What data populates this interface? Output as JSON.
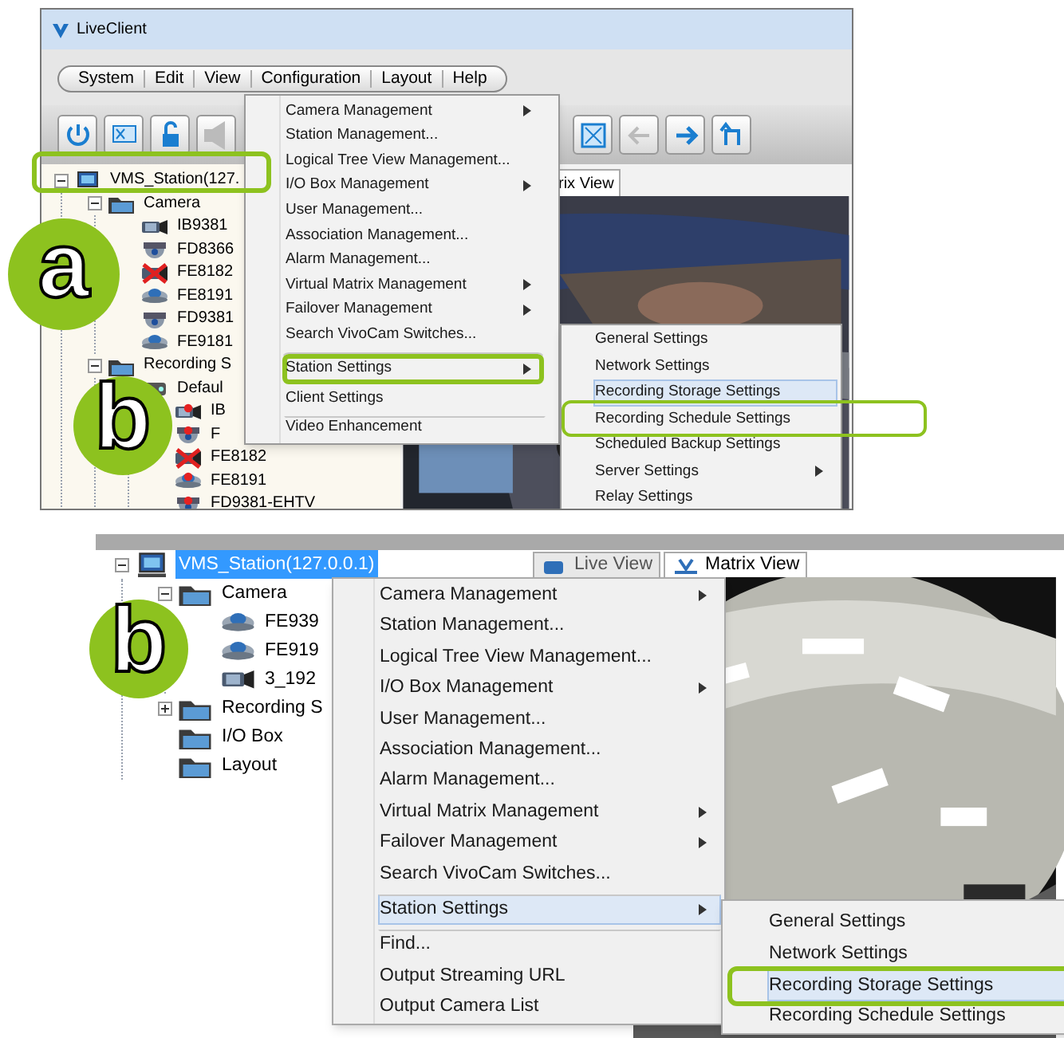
{
  "top_screenshot": {
    "window_title": "LiveClient",
    "menu_bar": [
      "System",
      "Edit",
      "View",
      "Configuration",
      "Layout",
      "Help"
    ],
    "tabs": [
      {
        "label": "rix View"
      }
    ],
    "tree": [
      {
        "label": "VMS_Station(127.",
        "kind": "station",
        "selected": false,
        "expanded": true,
        "children": [
          {
            "label": "Camera",
            "kind": "folder",
            "selected": false,
            "expanded": true,
            "children": [
              {
                "label": "IB9381",
                "kind": "bullet",
                "selected": false
              },
              {
                "label": "FD8366",
                "kind": "dome",
                "selected": false
              },
              {
                "label": "FE8182",
                "kind": "offline",
                "selected": false
              },
              {
                "label": "FE8191",
                "kind": "fisheye",
                "selected": false
              },
              {
                "label": "FD9381",
                "kind": "dome",
                "selected": false
              },
              {
                "label": "FE9181",
                "kind": "fisheye",
                "selected": false
              }
            ]
          },
          {
            "label": "Recording S",
            "kind": "folder",
            "selected": false,
            "expanded": true,
            "children": [
              {
                "label": "Defaul",
                "kind": "storage",
                "selected": false,
                "children": [
                  {
                    "label": "IB",
                    "kind": "bullet",
                    "recording": true,
                    "selected": false
                  },
                  {
                    "label": "F",
                    "kind": "dome",
                    "recording": true,
                    "selected": false
                  },
                  {
                    "label": "FE8182",
                    "kind": "offline",
                    "selected": false
                  },
                  {
                    "label": "FE8191",
                    "kind": "fisheye",
                    "recording": true,
                    "selected": false
                  },
                  {
                    "label": "FD9381-EHTV",
                    "kind": "dome",
                    "recording": true,
                    "selected": false
                  }
                ]
              }
            ]
          }
        ]
      }
    ],
    "context_menu": [
      {
        "label": "Camera Management",
        "has_submenu": true,
        "separator_before": false,
        "selected": false,
        "highlighted": false
      },
      {
        "label": "Station Management...",
        "has_submenu": false,
        "separator_before": false,
        "selected": false,
        "highlighted": false
      },
      {
        "label": "Logical Tree View Management...",
        "has_submenu": false,
        "separator_before": false,
        "selected": false,
        "highlighted": false
      },
      {
        "label": "I/O Box Management",
        "has_submenu": true,
        "separator_before": false,
        "selected": false,
        "highlighted": false
      },
      {
        "label": "User Management...",
        "has_submenu": false,
        "separator_before": false,
        "selected": false,
        "highlighted": false
      },
      {
        "label": "Association Management...",
        "has_submenu": false,
        "separator_before": false,
        "selected": false,
        "highlighted": false
      },
      {
        "label": "Alarm Management...",
        "has_submenu": false,
        "separator_before": false,
        "selected": false,
        "highlighted": false
      },
      {
        "label": "Virtual Matrix Management",
        "has_submenu": true,
        "separator_before": false,
        "selected": false,
        "highlighted": false
      },
      {
        "label": "Failover Management",
        "has_submenu": true,
        "separator_before": false,
        "selected": false,
        "highlighted": false
      },
      {
        "label": "Search VivoCam Switches...",
        "has_submenu": false,
        "separator_before": false,
        "selected": false,
        "highlighted": false
      },
      {
        "label": "Station Settings",
        "has_submenu": true,
        "separator_before": true,
        "selected": false,
        "highlighted": true
      },
      {
        "label": "Client Settings",
        "has_submenu": false,
        "separator_before": false,
        "selected": false,
        "highlighted": false
      },
      {
        "label": "Video Enhancement",
        "has_submenu": false,
        "separator_before": true,
        "selected": false,
        "highlighted": false
      }
    ],
    "submenu": [
      {
        "label": "General Settings",
        "has_submenu": false,
        "selected": false
      },
      {
        "label": "Network Settings",
        "has_submenu": false,
        "selected": false
      },
      {
        "label": "Recording Storage Settings",
        "has_submenu": false,
        "selected": true
      },
      {
        "label": "Recording Schedule Settings",
        "has_submenu": false,
        "selected": false
      },
      {
        "label": "Scheduled Backup Settings",
        "has_submenu": false,
        "selected": false
      },
      {
        "label": "Server Settings",
        "has_submenu": true,
        "selected": false
      },
      {
        "label": "Relay Settings",
        "has_submenu": false,
        "selected": false
      }
    ],
    "callouts": [
      "a",
      "b"
    ]
  },
  "bottom_screenshot": {
    "tabs": [
      {
        "label": "Live View",
        "selected": false
      },
      {
        "label": "Matrix View",
        "selected": true
      }
    ],
    "tree": [
      {
        "label": "VMS_Station(127.0.0.1)",
        "kind": "station",
        "selected": true,
        "expanded": true,
        "children": [
          {
            "label": "Camera",
            "kind": "folder",
            "selected": false,
            "expanded": true,
            "children": [
              {
                "label": "FE939",
                "kind": "fisheye",
                "selected": false
              },
              {
                "label": "FE919",
                "kind": "fisheye",
                "selected": false
              },
              {
                "label": "3_192",
                "kind": "bullet",
                "selected": false
              }
            ]
          },
          {
            "label": "Recording S",
            "kind": "folder",
            "selected": false,
            "expanded": false
          },
          {
            "label": "I/O Box",
            "kind": "folder",
            "selected": false
          },
          {
            "label": "Layout",
            "kind": "folder",
            "selected": false
          }
        ]
      }
    ],
    "context_menu": [
      {
        "label": "Camera Management",
        "has_submenu": true,
        "separator_before": false,
        "selected": false
      },
      {
        "label": "Station Management...",
        "has_submenu": false,
        "separator_before": false,
        "selected": false
      },
      {
        "label": "Logical Tree View Management...",
        "has_submenu": false,
        "separator_before": false,
        "selected": false
      },
      {
        "label": "I/O Box Management",
        "has_submenu": true,
        "separator_before": false,
        "selected": false
      },
      {
        "label": "User Management...",
        "has_submenu": false,
        "separator_before": false,
        "selected": false
      },
      {
        "label": "Association Management...",
        "has_submenu": false,
        "separator_before": false,
        "selected": false
      },
      {
        "label": "Alarm Management...",
        "has_submenu": false,
        "separator_before": false,
        "selected": false
      },
      {
        "label": "Virtual Matrix Management",
        "has_submenu": true,
        "separator_before": false,
        "selected": false
      },
      {
        "label": "Failover Management",
        "has_submenu": true,
        "separator_before": false,
        "selected": false
      },
      {
        "label": "Search VivoCam Switches...",
        "has_submenu": false,
        "separator_before": false,
        "selected": false
      },
      {
        "label": "Station Settings",
        "has_submenu": true,
        "separator_before": true,
        "selected": true
      },
      {
        "label": "Find...",
        "has_submenu": false,
        "separator_before": true,
        "selected": false
      },
      {
        "label": "Output Streaming URL",
        "has_submenu": false,
        "separator_before": false,
        "selected": false
      },
      {
        "label": "Output Camera List",
        "has_submenu": false,
        "separator_before": false,
        "selected": false
      }
    ],
    "submenu": [
      {
        "label": "General Settings",
        "has_submenu": false,
        "selected": false
      },
      {
        "label": "Network Settings",
        "has_submenu": false,
        "selected": false
      },
      {
        "label": "Recording Storage Settings",
        "has_submenu": false,
        "selected": true
      },
      {
        "label": "Recording Schedule Settings",
        "has_submenu": false,
        "selected": false
      }
    ],
    "callouts": [
      "b"
    ]
  }
}
